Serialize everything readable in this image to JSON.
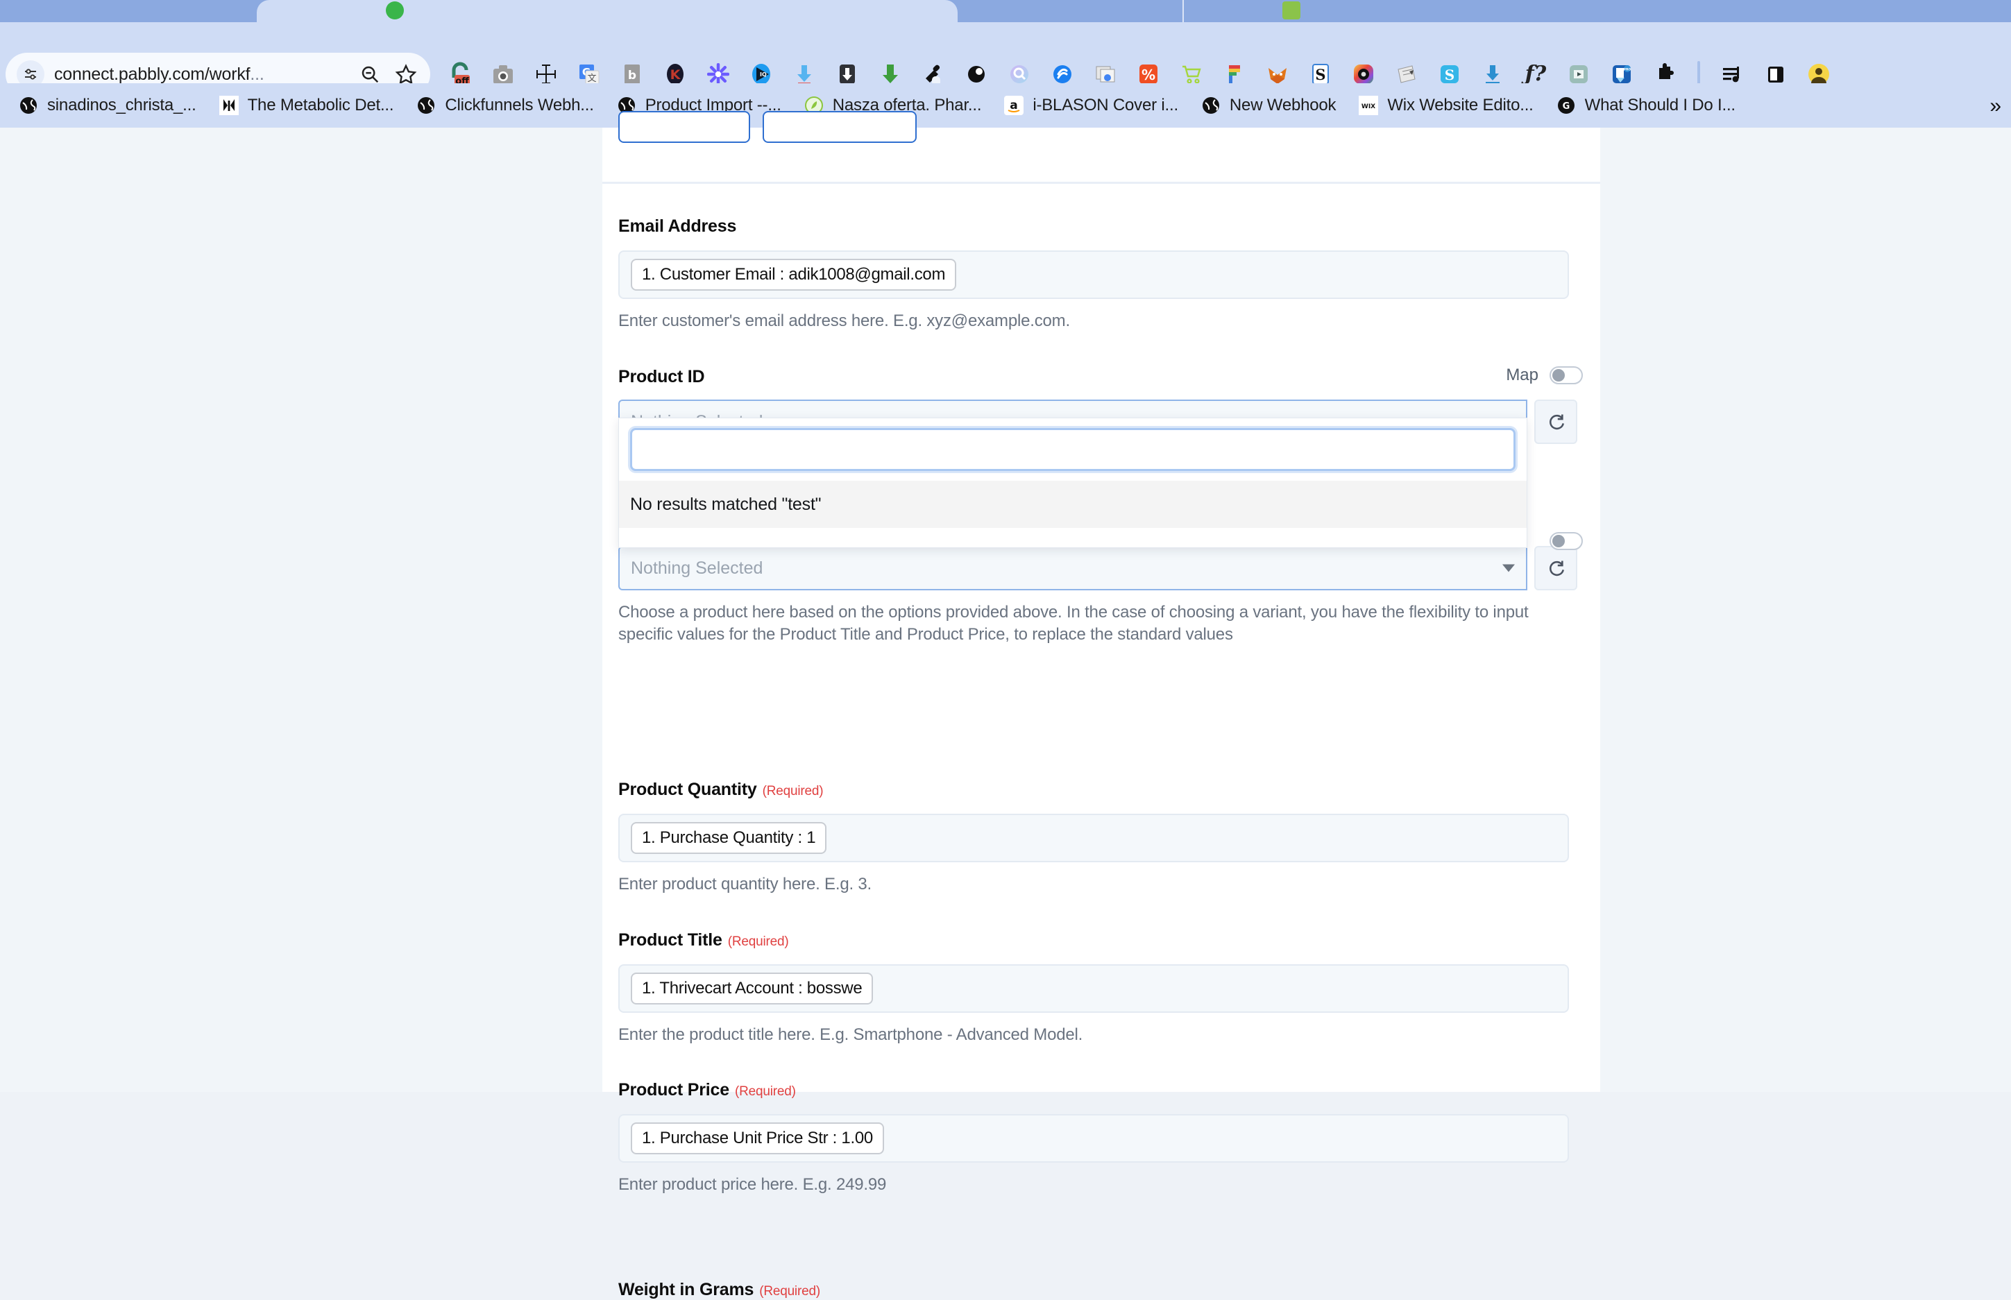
{
  "browser": {
    "omnibox": {
      "url_visible": "connect.pabbly.com/workf",
      "url_ellipsis": "...",
      "site_settings_icon": "tune-icon",
      "zoom_out_icon": "zoom-out-icon",
      "bookmark_icon": "star-icon"
    },
    "extensions": [
      {
        "name": "privacy-badger-off-icon",
        "label": "off",
        "color": "#2e7d62"
      },
      {
        "name": "camera-icon",
        "label": "",
        "color": "#9e9e9e"
      },
      {
        "name": "ruler-measure-icon",
        "label": "",
        "color": "#111111"
      },
      {
        "name": "google-translate-icon",
        "label": "G",
        "color": "#4285f4"
      },
      {
        "name": "bitly-icon",
        "label": "b",
        "color": "#9e9e9e"
      },
      {
        "name": "keepa-icon",
        "label": "K",
        "color": "#1b1b2b"
      },
      {
        "name": "sunburst-icon",
        "label": "",
        "color": "#6b5bff"
      },
      {
        "name": "iq-play-icon",
        "label": "IQ",
        "color": "#1e9bf0"
      },
      {
        "name": "download-blue-icon",
        "label": "",
        "color": "#56b4f0"
      },
      {
        "name": "download-dark-icon",
        "label": "",
        "color": "#2f3136"
      },
      {
        "name": "download-green-icon",
        "label": "",
        "color": "#3d9e3d"
      },
      {
        "name": "eyedropper-icon",
        "label": "",
        "color": "#111111"
      },
      {
        "name": "dark-reader-eye-icon",
        "label": "",
        "color": "#111111"
      },
      {
        "name": "search-orb-icon",
        "label": "",
        "color": "#b39ddb"
      },
      {
        "name": "shazam-icon",
        "label": "S",
        "color": "#1b7ff0"
      },
      {
        "name": "window-capture-icon",
        "label": "",
        "color": "#8a8f98"
      },
      {
        "name": "percent-orange-icon",
        "label": "%",
        "color": "#f04e23"
      },
      {
        "name": "shopping-cart-icon",
        "label": "",
        "color": "#a5d63f"
      },
      {
        "name": "figma-f-icon",
        "label": "F",
        "color": "#f24e1e"
      },
      {
        "name": "metamask-fox-icon",
        "label": "",
        "color": "#e2761b"
      },
      {
        "name": "grammarly-s-icon",
        "label": "S",
        "color": "#111111"
      },
      {
        "name": "color-ring-icon",
        "label": "",
        "color": "#e84a5f"
      },
      {
        "name": "notebook-icon",
        "label": "",
        "color": "#d7d7d7"
      },
      {
        "name": "scribe-s-icon",
        "label": "S",
        "color": "#35b6e8"
      },
      {
        "name": "download-manager-icon",
        "label": "",
        "color": "#2b8fd0"
      },
      {
        "name": "function-question-icon",
        "label": "f?",
        "color": "#111111"
      },
      {
        "name": "video-player-icon",
        "label": "",
        "color": "#8fb3ae"
      },
      {
        "name": "pdf-pro-icon",
        "label": "PRO",
        "color": "#1a5fb4"
      },
      {
        "name": "puzzle-extensions-icon",
        "label": "",
        "color": "#111111"
      }
    ],
    "right_controls": [
      {
        "name": "media-playlist-icon"
      },
      {
        "name": "side-panel-icon"
      },
      {
        "name": "profile-avatar-icon"
      }
    ],
    "bookmarks": [
      {
        "label": "sinadinos_christa_...",
        "icon": "globe-icon"
      },
      {
        "label": "The Metabolic Det...",
        "icon": "butterfly-icon"
      },
      {
        "label": "Clickfunnels Webh...",
        "icon": "globe-icon"
      },
      {
        "label": "Product Import --...",
        "icon": "globe-icon"
      },
      {
        "label": "Nasza oferta. Phar...",
        "icon": "leaf-icon"
      },
      {
        "label": "i-BLASON Cover i...",
        "icon": "amazon-icon"
      },
      {
        "label": "New Webhook",
        "icon": "globe-icon"
      },
      {
        "label": "Wix Website Edito...",
        "icon": "wix-icon"
      },
      {
        "label": "What Should I Do I...",
        "icon": "grammarly-g-icon"
      }
    ],
    "bookmarks_overflow": "»"
  },
  "form": {
    "email": {
      "label": "Email Address",
      "chip": "1. Customer Email : adik1008@gmail.com",
      "help": "Enter customer's email address here. E.g. xyz@example.com."
    },
    "product_id": {
      "label": "Product ID",
      "map_label": "Map",
      "map_on": false,
      "placeholder": "Nothing Selected",
      "refresh_icon": "refresh-icon",
      "dropdown": {
        "search_value": "",
        "no_results": "No results matched \"test\""
      }
    },
    "product_variant": {
      "placeholder": "Nothing Selected",
      "map_on": false,
      "refresh_icon": "refresh-icon",
      "help": "Choose a product here based on the options provided above. In the case of choosing a variant, you have the flexibility to input specific values for the Product Title and Product Price, to replace the standard values"
    },
    "product_quantity": {
      "label": "Product Quantity",
      "required": "(Required)",
      "chip": "1. Purchase Quantity : 1",
      "help": "Enter product quantity here. E.g. 3."
    },
    "product_title": {
      "label": "Product Title",
      "required": "(Required)",
      "chip": "1. Thrivecart Account : bosswe",
      "help": "Enter the product title here. E.g. Smartphone - Advanced Model."
    },
    "product_price": {
      "label": "Product Price",
      "required": "(Required)",
      "chip": "1. Purchase Unit Price Str : 1.00",
      "help": "Enter product price here. E.g. 249.99"
    },
    "weight": {
      "label": "Weight in Grams",
      "required": "(Required)"
    }
  },
  "colors": {
    "chrome_bg": "#cfdcf5",
    "tab_active": "#cfdcf5",
    "page_bg": "#f1f5f9",
    "panel_bg": "#ffffff",
    "accent_blue": "#8fb4e8",
    "required_red": "#e04141"
  }
}
